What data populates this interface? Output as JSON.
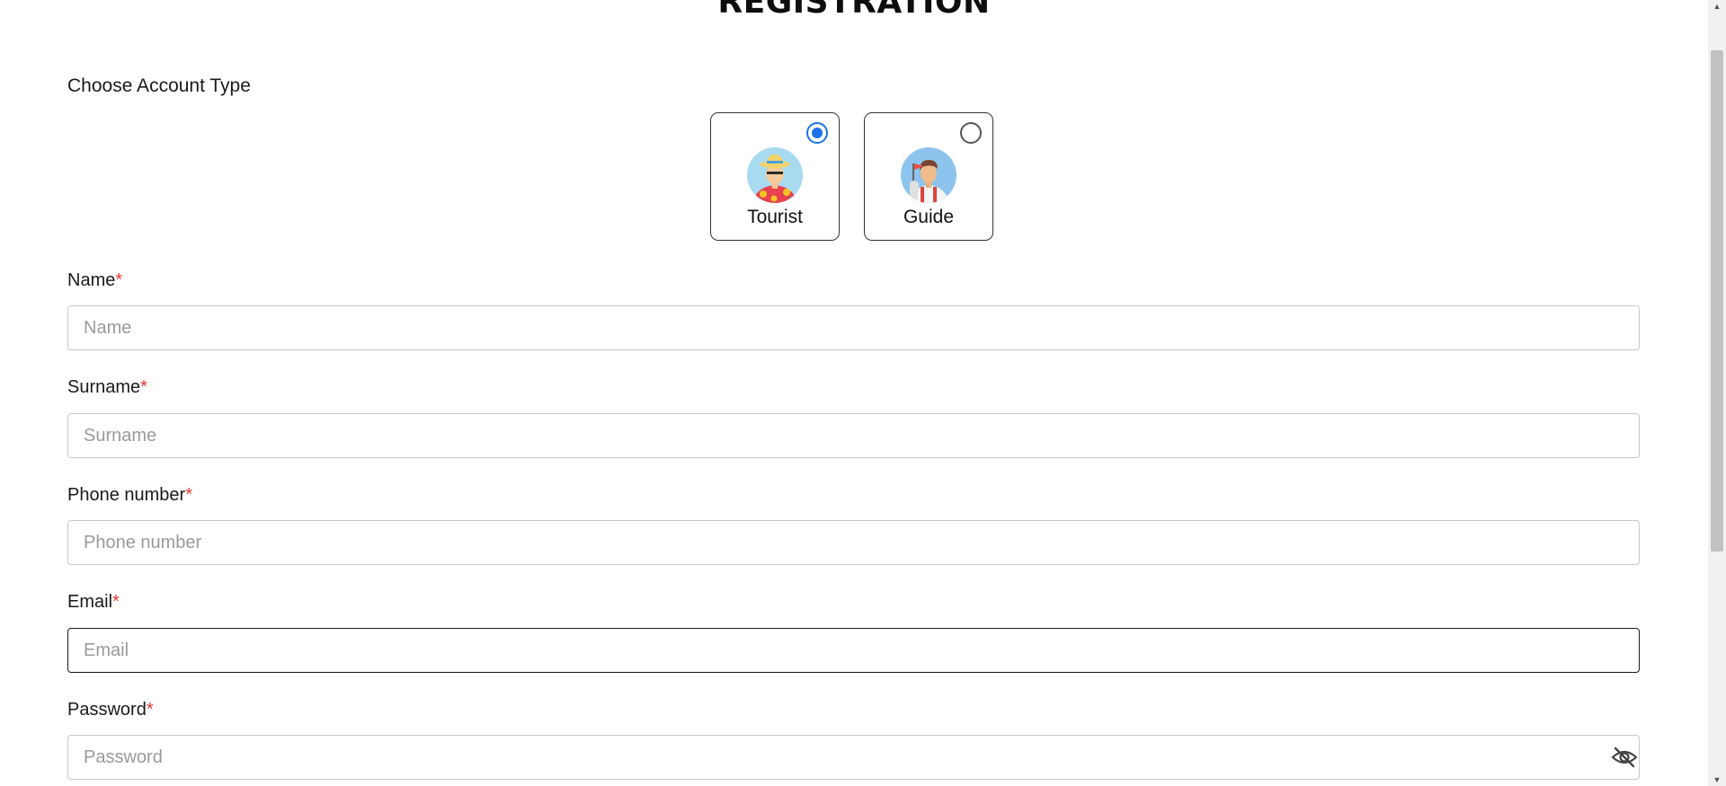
{
  "page": {
    "title": "REGISTRATION"
  },
  "account_type": {
    "label": "Choose Account Type",
    "options": [
      {
        "label": "Tourist",
        "selected": true,
        "icon": "tourist-avatar-icon"
      },
      {
        "label": "Guide",
        "selected": false,
        "icon": "guide-avatar-icon"
      }
    ]
  },
  "form": {
    "required_marker": "*",
    "name": {
      "label": "Name",
      "placeholder": "Name",
      "value": ""
    },
    "surname": {
      "label": "Surname",
      "placeholder": "Surname",
      "value": ""
    },
    "phone": {
      "label": "Phone number",
      "placeholder": "Phone number",
      "value": ""
    },
    "email": {
      "label": "Email",
      "placeholder": "Email",
      "value": "",
      "focused": true
    },
    "password": {
      "label": "Password",
      "placeholder": "Password",
      "value": "",
      "visibility_icon": "eye-off-icon"
    }
  },
  "colors": {
    "accent": "#1a73e8",
    "required": "#e53935",
    "border": "#c8c8c8",
    "focus_border": "#1a1a1a"
  },
  "scrollbar": {
    "up_arrow": "▲",
    "down_arrow": "▼"
  }
}
